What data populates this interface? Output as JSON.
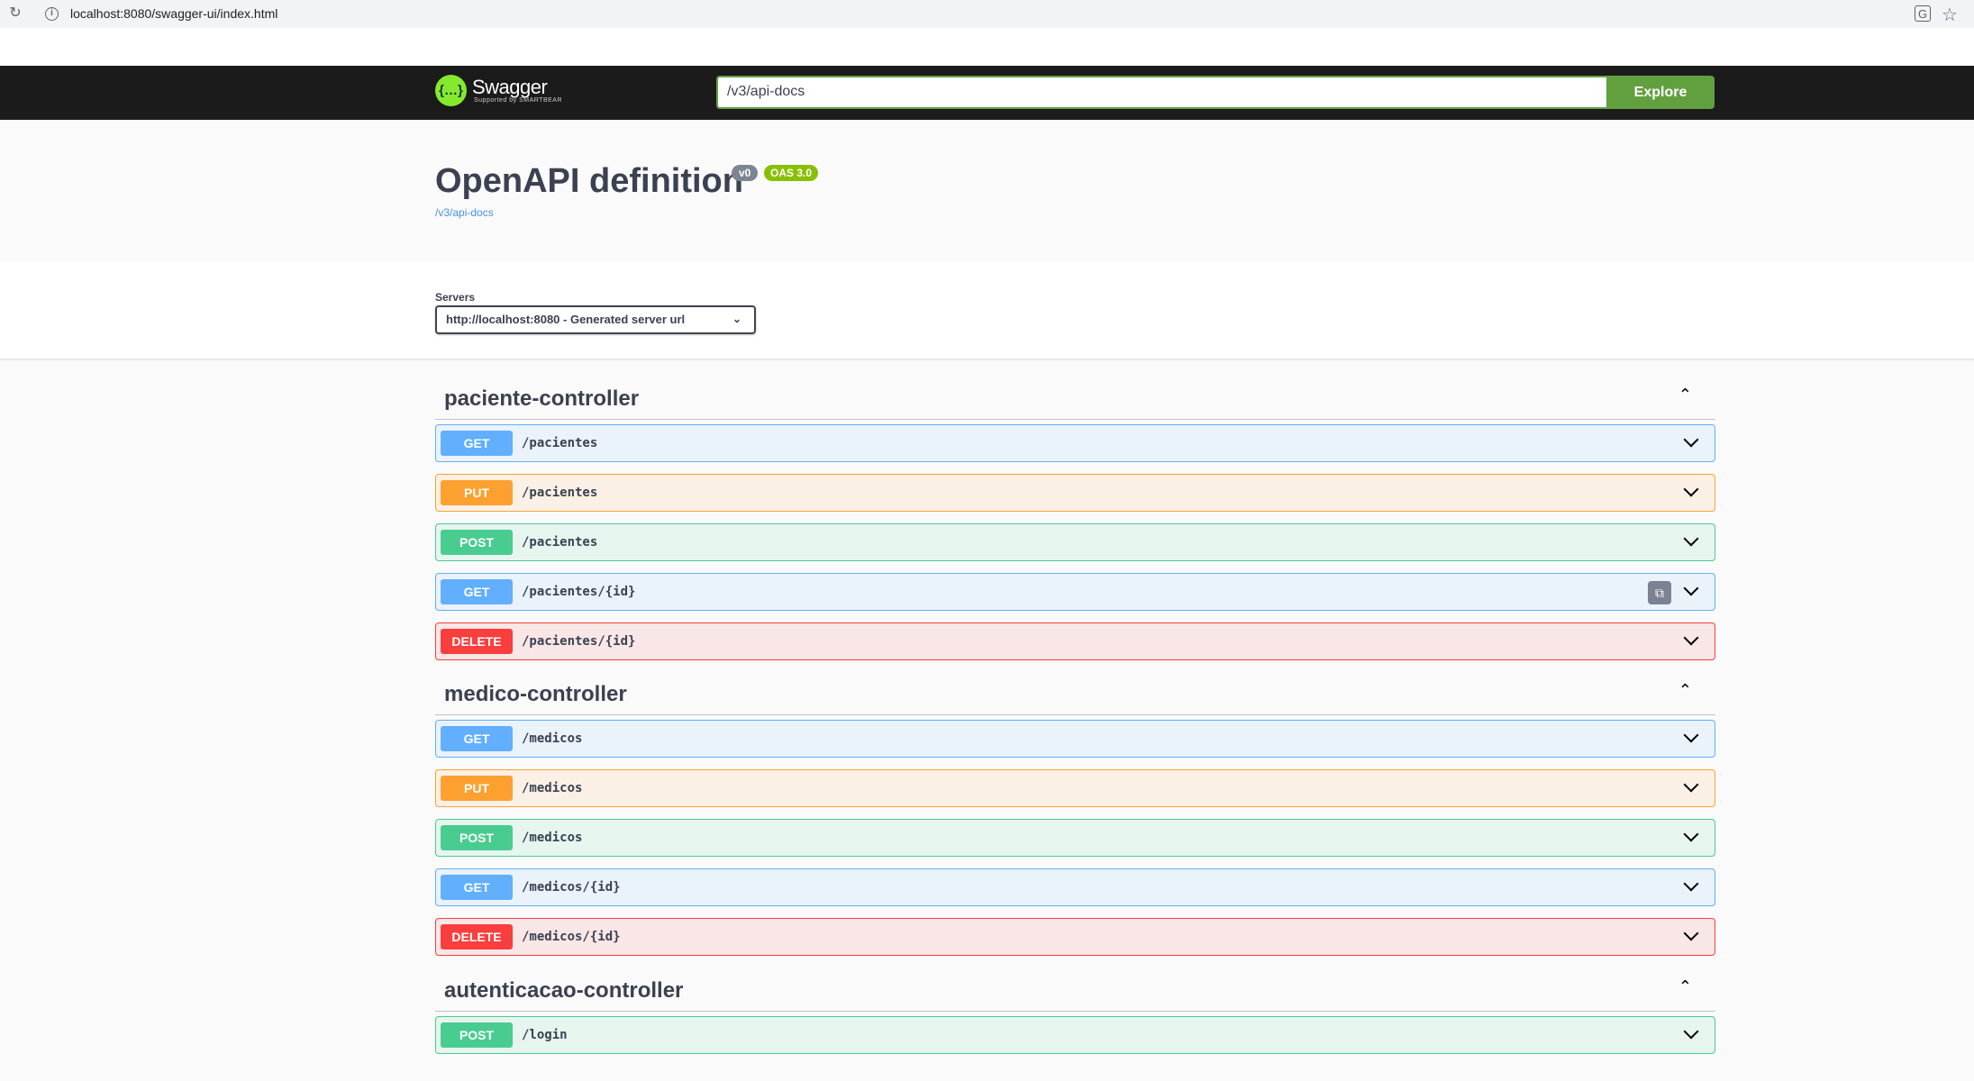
{
  "browser": {
    "url": "localhost:8080/swagger-ui/index.html",
    "reload_icon": "reload-icon",
    "star_icon": "star-icon"
  },
  "topbar": {
    "logo_glyph": "{…}",
    "logo_text": "Swagger",
    "logo_sub": "Supported by SMARTBEAR",
    "url_value": "/v3/api-docs",
    "explore_label": "Explore"
  },
  "info": {
    "title": "OpenAPI definition",
    "version": "v0",
    "oas": "OAS 3.0",
    "link": "/v3/api-docs"
  },
  "servers": {
    "label": "Servers",
    "selected": "http://localhost:8080 - Generated server url"
  },
  "tags": [
    {
      "name": "paciente-controller",
      "ops": [
        {
          "method": "GET",
          "path": "/pacientes"
        },
        {
          "method": "PUT",
          "path": "/pacientes"
        },
        {
          "method": "POST",
          "path": "/pacientes"
        },
        {
          "method": "GET",
          "path": "/pacientes/{id}",
          "copy_icon": true
        },
        {
          "method": "DELETE",
          "path": "/pacientes/{id}"
        }
      ]
    },
    {
      "name": "medico-controller",
      "ops": [
        {
          "method": "GET",
          "path": "/medicos"
        },
        {
          "method": "PUT",
          "path": "/medicos"
        },
        {
          "method": "POST",
          "path": "/medicos"
        },
        {
          "method": "GET",
          "path": "/medicos/{id}"
        },
        {
          "method": "DELETE",
          "path": "/medicos/{id}"
        }
      ]
    },
    {
      "name": "autenticacao-controller",
      "ops": [
        {
          "method": "POST",
          "path": "/login"
        }
      ]
    }
  ]
}
